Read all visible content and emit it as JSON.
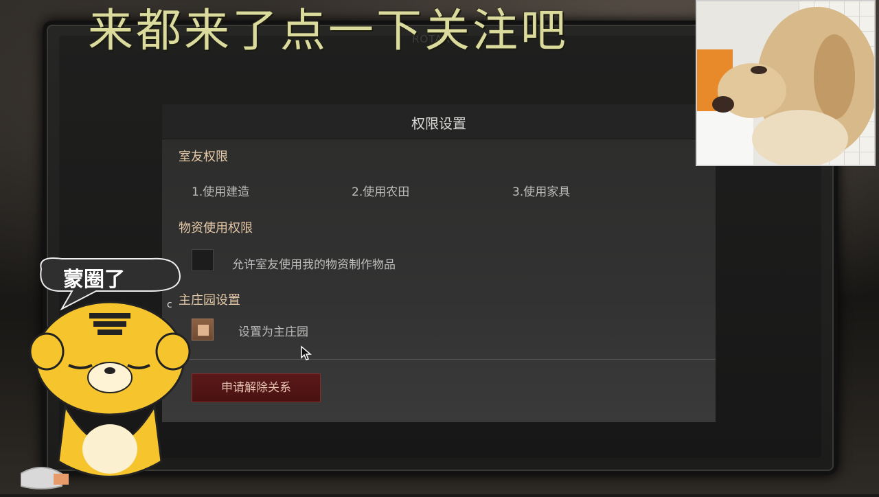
{
  "overlay": {
    "banner_text": "来都来了点一下关注吧",
    "sticker_text": "蒙圈了"
  },
  "background": {
    "ghost_top_text": "ROTAR",
    "ghost_bottom_text": " "
  },
  "dialog": {
    "title": "权限设置",
    "roommate_section": {
      "title": "室友权限",
      "items": [
        "1.使用建造",
        "2.使用农田",
        "3.使用家具"
      ]
    },
    "materials_section": {
      "title": "物资使用权限",
      "checkbox_label": "允许室友使用我的物资制作物品",
      "checked": false
    },
    "manor_section": {
      "title": "主庄园设置",
      "checkbox_label": "设置为主庄园",
      "checked": true
    },
    "release_button_label": "申请解除关系"
  },
  "colors": {
    "banner": "#dcdb9e",
    "section_title": "#e6c9a6",
    "release_button_bg": "#4a1212",
    "checked_box": "#7a543a"
  }
}
